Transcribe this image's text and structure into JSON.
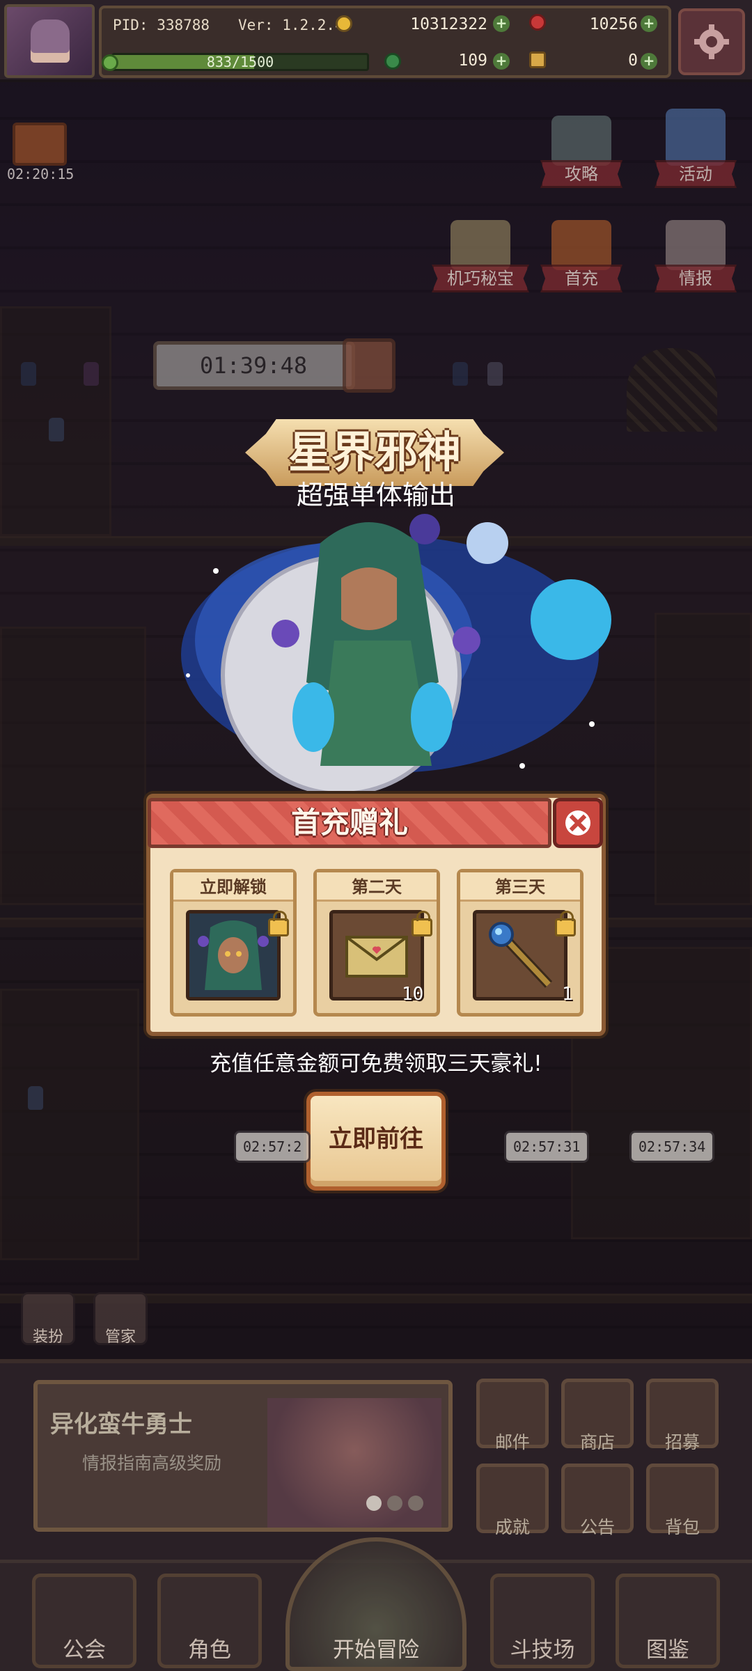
{
  "status_bar": {
    "pid": "PID: 338788",
    "version": "Ver: 1.2.2.4",
    "gold": "10312322",
    "gems": "10256",
    "clover": "109",
    "keys": "0",
    "xp_text": "833/1500",
    "xp_progress": 0.555
  },
  "gift_timer": "02:20:15",
  "side_buttons": {
    "guide": "攻略",
    "events": "活动",
    "machine_treasure": "机巧秘宝",
    "first_charge": "首充",
    "intel": "情报"
  },
  "countdown": "01:39:48",
  "hero": {
    "title": "星界邪神",
    "subtitle": "超强单体输出"
  },
  "gift_panel": {
    "title": "首充赠礼",
    "rewards": [
      {
        "label": "立即解锁",
        "item": "character-portrait",
        "qty": ""
      },
      {
        "label": "第二天",
        "item": "letter-envelope",
        "qty": "10"
      },
      {
        "label": "第三天",
        "item": "magic-staff",
        "qty": "1"
      }
    ],
    "description": "充值任意金额可免费领取三天豪礼!",
    "go_button": "立即前往"
  },
  "bubble_timers": [
    "02:57:2",
    "02:57:31",
    "02:57:34"
  ],
  "mini_buttons": {
    "dress": "装扮",
    "butler": "管家"
  },
  "event_card": {
    "title": "异化蛮牛勇士",
    "subtitle": "情报指南高级奖励",
    "pages": 3,
    "active_page": 1
  },
  "menu_grid": {
    "mail": "邮件",
    "shop": "商店",
    "recruit": "招募",
    "achievements": "成就",
    "announcement": "公告",
    "backpack": "背包"
  },
  "bottom_nav": {
    "guild": "公会",
    "character": "角色",
    "adventure": "开始冒险",
    "arena": "斗技场",
    "codex": "图鉴"
  },
  "colors": {
    "panel_bg": "#f3e0bf",
    "header_red": "#e06a5e",
    "button_cream": "#f8e6c0",
    "frame_brown": "#8a5a34"
  }
}
